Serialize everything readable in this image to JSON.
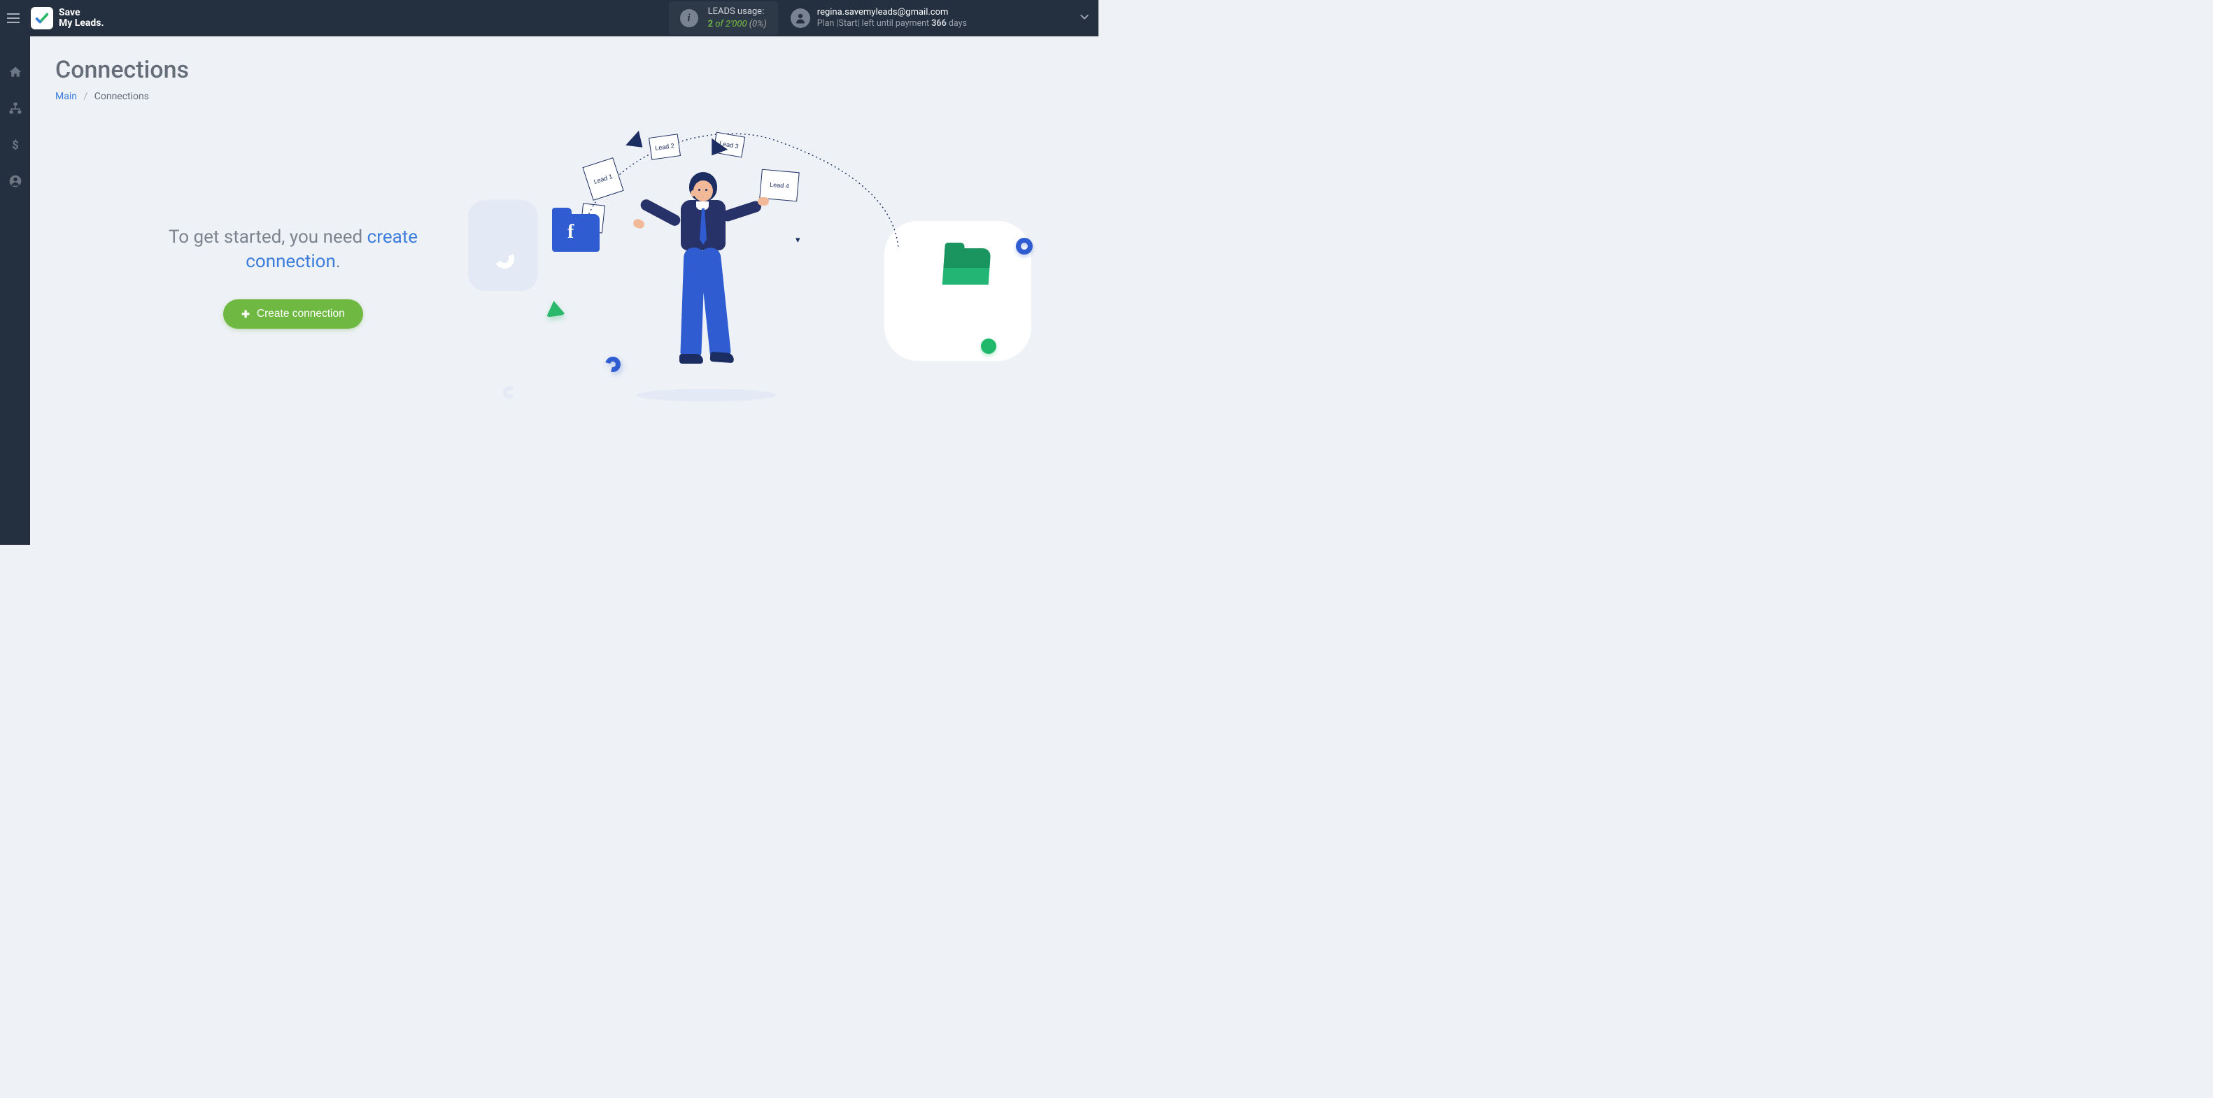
{
  "header": {
    "brand_line1": "Save",
    "brand_line2": "My Leads",
    "usage_label": "LEADS usage:",
    "usage_used": "2",
    "usage_of": " of ",
    "usage_limit": "2'000",
    "usage_pct": " (0%)",
    "account_email": "regina.savemyleads@gmail.com",
    "account_plan_prefix": "Plan |Start| left until payment ",
    "account_plan_days": "366",
    "account_plan_suffix": " days"
  },
  "page": {
    "title": "Connections",
    "breadcrumb_main": "Main",
    "breadcrumb_current": "Connections",
    "hero_text_pre": "To get started, you need ",
    "hero_text_link": "create connection",
    "hero_text_post": ".",
    "create_button": "Create connection"
  },
  "illustration": {
    "note1": "Lead 1",
    "note2": "Lead 2",
    "note3": "Lead 3",
    "note4": "Lead 4",
    "fb_letter": "f"
  }
}
